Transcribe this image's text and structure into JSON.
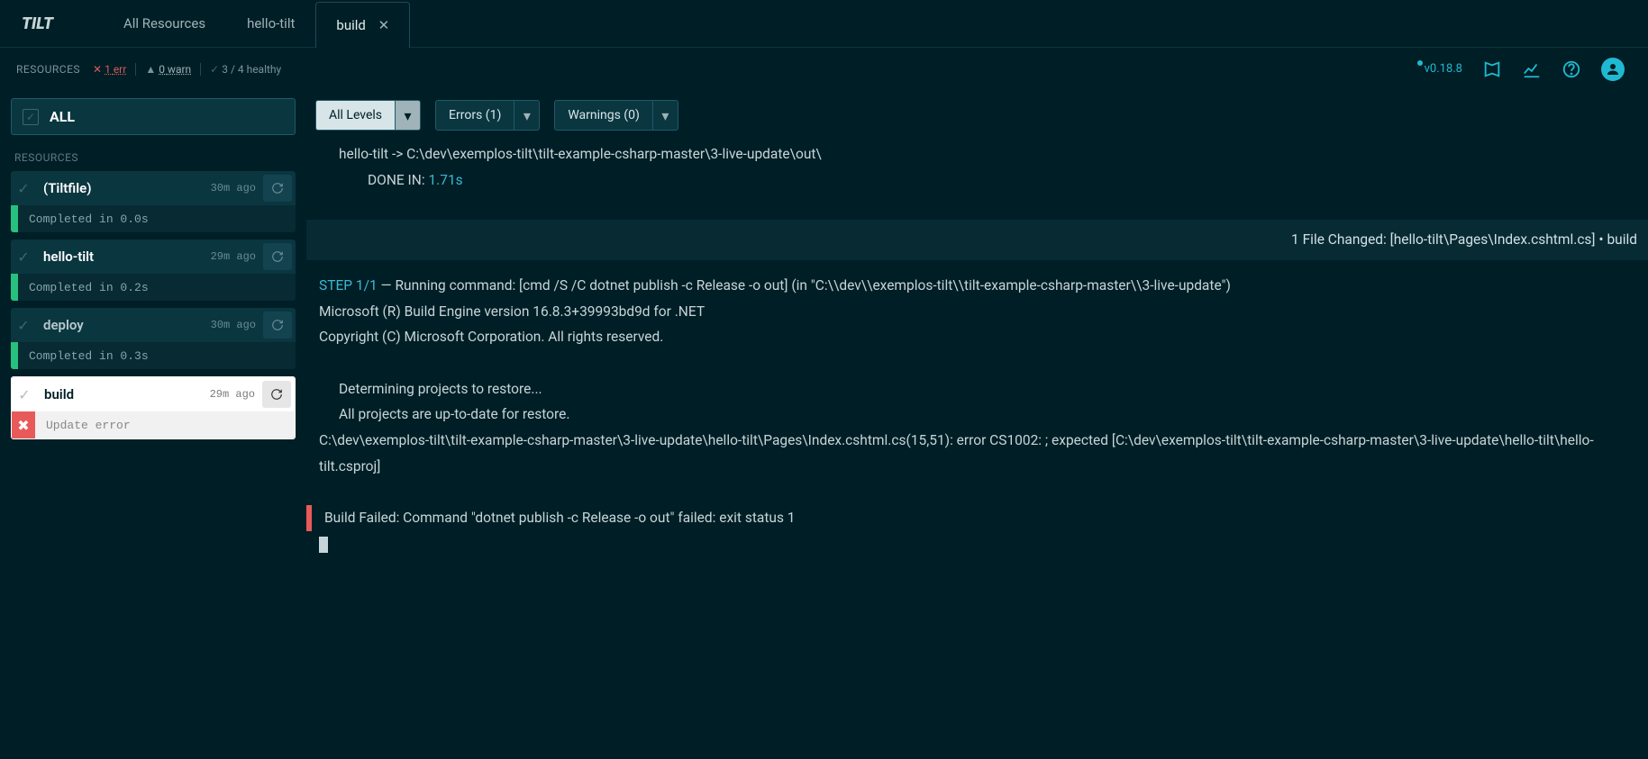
{
  "tabs": [
    {
      "label": "All Resources",
      "active": false
    },
    {
      "label": "hello-tilt",
      "active": false
    },
    {
      "label": "build",
      "active": true
    }
  ],
  "statusbar": {
    "label": "RESOURCES",
    "err_count": "1",
    "err_label": "err",
    "warn_count": "0",
    "warn_label": "warn",
    "healthy": "3 / 4 healthy",
    "version": "v0.18.8"
  },
  "sidebar": {
    "all_label": "ALL",
    "section": "RESOURCES",
    "items": [
      {
        "name": "(Tiltfile)",
        "time": "30m ago",
        "status": "Completed in 0.0s",
        "ok": true,
        "selected": false,
        "dim": false
      },
      {
        "name": "hello-tilt",
        "time": "29m ago",
        "status": "Completed in 0.2s",
        "ok": true,
        "selected": false,
        "dim": false
      },
      {
        "name": "deploy",
        "time": "30m ago",
        "status": "Completed in 0.3s",
        "ok": true,
        "selected": false,
        "dim": true
      },
      {
        "name": "build",
        "time": "29m ago",
        "status": "Update error",
        "ok": false,
        "selected": true,
        "dim": false
      }
    ]
  },
  "filters": {
    "levels": "All Levels",
    "errors": "Errors (1)",
    "warnings": "Warnings (0)"
  },
  "log": {
    "line1": "hello-tilt -> C:\\dev\\exemplos-tilt\\tilt-example-csharp-master\\3-live-update\\out\\",
    "done_label": "DONE IN:",
    "done_val": "1.71s",
    "file_changed": "1 File Changed: [hello-tilt\\Pages\\Index.cshtml.cs] • build",
    "step": "STEP 1/1",
    "step_rest": " — Running command: [cmd /S /C dotnet publish -c Release -o out] (in \"C:\\\\dev\\\\exemplos-tilt\\\\tilt-example-csharp-master\\\\3-live-update\")",
    "ms1": "Microsoft (R) Build Engine version 16.8.3+39993bd9d for .NET",
    "ms2": "Copyright (C) Microsoft Corporation. All rights reserved.",
    "det": "Determining projects to restore...",
    "upd": "All projects are up-to-date for restore.",
    "err": "C:\\dev\\exemplos-tilt\\tilt-example-csharp-master\\3-live-update\\hello-tilt\\Pages\\Index.cshtml.cs(15,51): error CS1002: ; expected [C:\\dev\\exemplos-tilt\\tilt-example-csharp-master\\3-live-update\\hello-tilt\\hello-tilt.csproj]",
    "fail": "Build Failed: Command \"dotnet publish -c Release -o out\" failed: exit status 1"
  }
}
